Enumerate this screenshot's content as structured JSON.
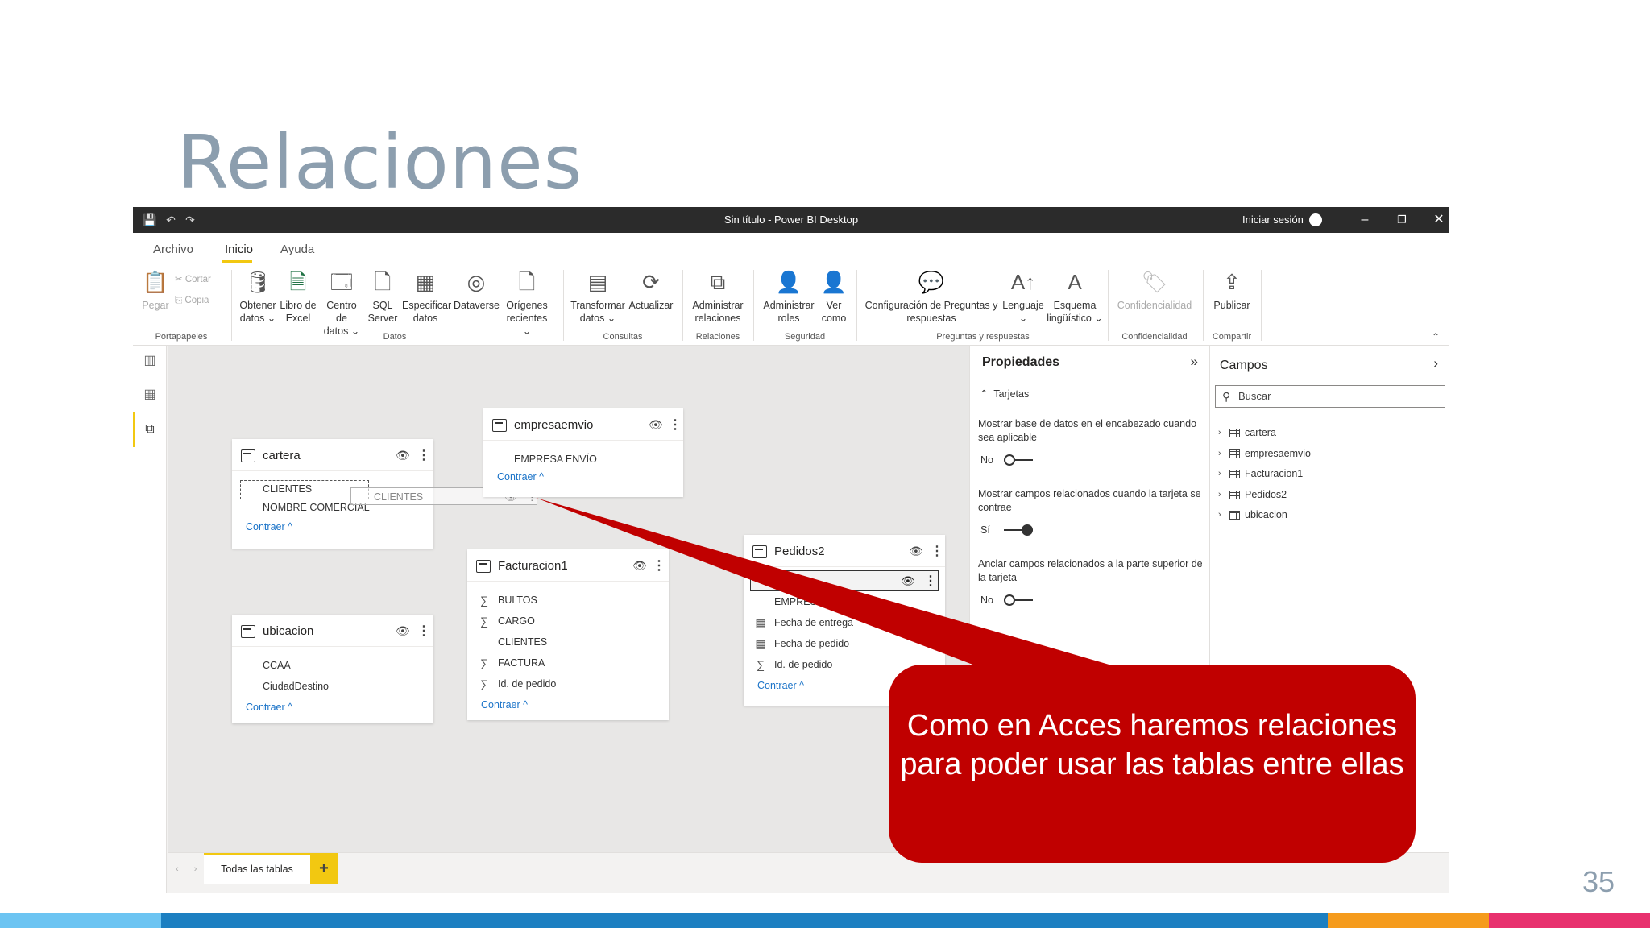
{
  "slide": {
    "title": "Relaciones",
    "page_number": "35",
    "bottom_bar_colors": [
      "#6cc4f2",
      "#1c7fc1",
      "#f59b1c",
      "#e8316e"
    ]
  },
  "window": {
    "title": "Sin título - Power BI Desktop",
    "signin": "Iniciar sesión"
  },
  "menu": {
    "tabs": [
      "Archivo",
      "Inicio",
      "Ayuda"
    ],
    "active": "Inicio"
  },
  "ribbon": {
    "pegar": "Pegar",
    "cortar": "Cortar",
    "copia": "Copia",
    "obtener_datos": "Obtener\ndatos ⌄",
    "libro_excel": "Libro de\nExcel",
    "centro_datos": "Centro de\ndatos ⌄",
    "sql_server": "SQL\nServer",
    "especificar_datos": "Especificar\ndatos",
    "dataverse": "Dataverse",
    "origenes": "Orígenes\nrecientes ⌄",
    "transformar": "Transformar\ndatos ⌄",
    "actualizar": "Actualizar",
    "admin_relaciones": "Administrar\nrelaciones",
    "admin_roles": "Administrar\nroles",
    "ver_como": "Ver\ncomo",
    "config_preguntas": "Configuración de Preguntas y\nrespuestas",
    "lenguaje": "Lenguaje\n⌄",
    "esquema": "Esquema\nlingüístico ⌄",
    "confidencialidad": "Confidencialidad",
    "publicar": "Publicar",
    "groups": {
      "portapapeles": "Portapapeles",
      "datos": "Datos",
      "consultas": "Consultas",
      "relaciones": "Relaciones",
      "seguridad": "Seguridad",
      "preguntas": "Preguntas y respuestas",
      "confidencialidad": "Confidencialidad",
      "compartir": "Compartir"
    }
  },
  "tables": {
    "cartera": {
      "name": "cartera",
      "fields": [
        "CLIENTES",
        "NOMBRE COMERCIAL"
      ],
      "collapse": "Contraer ^"
    },
    "empresaemvio": {
      "name": "empresaemvio",
      "fields": [
        "EMPRESA ENVÍO"
      ],
      "collapse": "Contraer ^"
    },
    "facturacion1": {
      "name": "Facturacion1",
      "fields": [
        "BULTOS",
        "CARGO",
        "CLIENTES",
        "FACTURA",
        "Id. de pedido"
      ],
      "collapse": "Contraer ^"
    },
    "pedidos2": {
      "name": "Pedidos2",
      "fields": [
        "EMPRESA E",
        "Fecha de entrega",
        "Fecha de pedido",
        "Id. de pedido"
      ],
      "collapse": "Contraer ^"
    },
    "ubicacion": {
      "name": "ubicacion",
      "fields": [
        "CCAA",
        "CiudadDestino"
      ],
      "collapse": "Contraer ^"
    },
    "drag_ghost": "CLIENTES"
  },
  "tabs_bar": {
    "tab": "Todas las tablas",
    "add": "+"
  },
  "properties": {
    "title": "Propiedades",
    "section": "Tarjetas",
    "opt1_desc": "Mostrar base de datos en el encabezado cuando sea aplicable",
    "opt1_value": "No",
    "opt1_on": false,
    "opt2_desc": "Mostrar campos relacionados cuando la tarjeta se contrae",
    "opt2_value": "Sí",
    "opt2_on": true,
    "opt3_desc": "Anclar campos relacionados a la parte superior de la tarjeta",
    "opt3_value": "No",
    "opt3_on": false
  },
  "fields_pane": {
    "title": "Campos",
    "search_placeholder": "Buscar",
    "items": [
      "cartera",
      "empresaemvio",
      "Facturacion1",
      "Pedidos2",
      "ubicacion"
    ]
  },
  "callout": {
    "text": "Como en Acces haremos relaciones para poder usar las tablas entre ellas",
    "color": "#c00000"
  }
}
